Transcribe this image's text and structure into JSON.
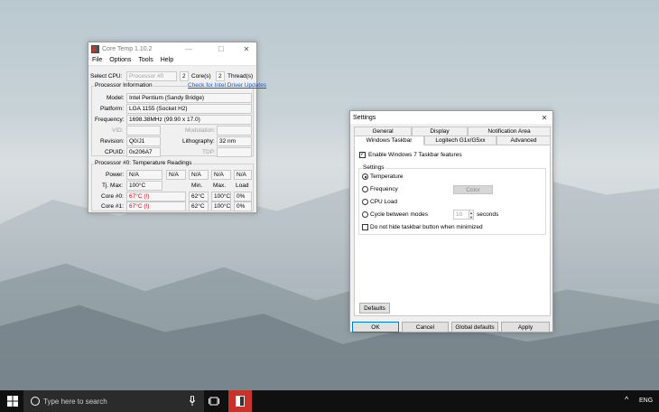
{
  "coretemp": {
    "title": "Core Temp 1.10.2",
    "menu": [
      "File",
      "Options",
      "Tools",
      "Help"
    ],
    "select_cpu_label": "Select CPU:",
    "processor_select": "Processor #0",
    "cores_value": "2",
    "cores_label": "Core(s)",
    "threads_value": "2",
    "threads_label": "Thread(s)",
    "proc_info_title": "Processor Information",
    "driver_link": "Check for Intel Driver Updates",
    "model_label": "Model:",
    "model_value": "Intel Pentium (Sandy Bridge)",
    "platform_label": "Platform:",
    "platform_value": "LGA 1155 (Socket H2)",
    "frequency_label": "Frequency:",
    "frequency_value": "1698.38MHz (99.90 x 17.0)",
    "vid_label": "VID:",
    "modulation_label": "Modulation:",
    "revision_label": "Revision:",
    "revision_value": "Q0/J1",
    "lithography_label": "Lithography:",
    "lithography_value": "32 nm",
    "cpuid_label": "CPUID:",
    "cpuid_value": "0x206A7",
    "tdp_label": "TDP:",
    "temp_title": "Processor #0: Temperature Readings",
    "power_label": "Power:",
    "power_values": [
      "N/A",
      "N/A",
      "N/A",
      "N/A",
      "N/A"
    ],
    "tjmax_label": "Tj. Max:",
    "tjmax_value": "100°C",
    "min_header": "Min.",
    "max_header": "Max.",
    "load_header": "Load",
    "cores": [
      {
        "label": "Core #0:",
        "temp": "67°C (!)",
        "min": "62°C",
        "max": "100°C",
        "load": "0%"
      },
      {
        "label": "Core #1:",
        "temp": "67°C (!)",
        "min": "62°C",
        "max": "100°C",
        "load": "0%"
      }
    ]
  },
  "settings": {
    "title": "Settings",
    "tabs_row1": [
      "General",
      "Display",
      "Notification Area"
    ],
    "tabs_row2": [
      "Windows Taskbar",
      "Logitech G1x/G5xx",
      "Advanced"
    ],
    "enable_label": "Enable Windows 7 Taskbar features",
    "group_title": "Settings",
    "opt_temperature": "Temperature",
    "opt_frequency": "Frequency",
    "color_button": "Color",
    "opt_cpuload": "CPU Load",
    "opt_cycle": "Cycle between modes",
    "cycle_value": "10",
    "seconds_label": "seconds",
    "no_hide_label": "Do not hide taskbar button when minimized",
    "defaults_button": "Defaults",
    "ok_button": "OK",
    "cancel_button": "Cancel",
    "global_defaults_button": "Global defaults",
    "apply_button": "Apply"
  },
  "taskbar": {
    "search_placeholder": "Type here to search",
    "language": "ENG"
  }
}
